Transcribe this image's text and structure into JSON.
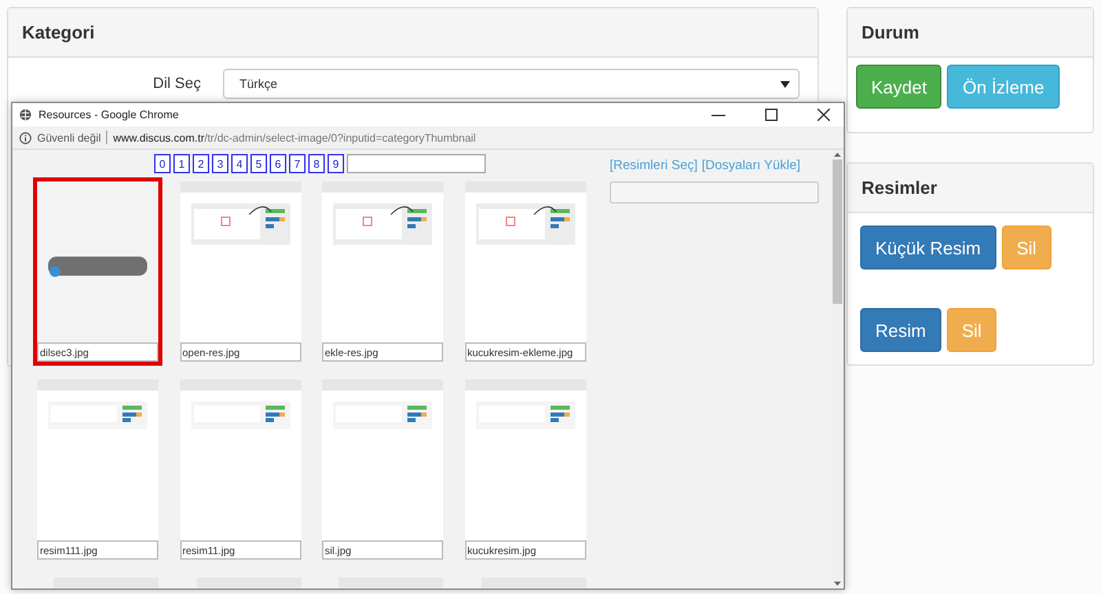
{
  "category_panel": {
    "title": "Kategori",
    "language_label": "Dil Seç",
    "language_value": "Türkçe"
  },
  "status_panel": {
    "title": "Durum",
    "buttons": [
      {
        "label": "Kaydet",
        "kind": "success"
      },
      {
        "label": "Ön İzleme",
        "kind": "info"
      }
    ]
  },
  "images_panel": {
    "title": "Resimler",
    "rows": [
      {
        "buttons": [
          {
            "label": "Küçük Resim",
            "kind": "primary"
          },
          {
            "label": "Sil",
            "kind": "warning"
          }
        ]
      },
      {
        "buttons": [
          {
            "label": "Resim",
            "kind": "primary"
          },
          {
            "label": "Sil",
            "kind": "warning"
          }
        ]
      }
    ]
  },
  "popup": {
    "window_title": "Resources - Google Chrome",
    "security_label": "Güvenli değil",
    "url_host": "www.discus.com.tr",
    "url_path": "/tr/dc-admin/select-image/0?inputid=categoryThumbnail",
    "pages": [
      "0",
      "1",
      "2",
      "3",
      "4",
      "5",
      "6",
      "7",
      "8",
      "9"
    ],
    "links": [
      "[Resimleri Seç]",
      "[Dosyaları Yükle]"
    ],
    "files": [
      {
        "name": "dilsec3.jpg",
        "selected": true
      },
      {
        "name": "open-res.jpg",
        "selected": false
      },
      {
        "name": "ekle-res.jpg",
        "selected": false
      },
      {
        "name": "kucukresim-ekleme.jpg",
        "selected": false
      },
      {
        "name": "resim111.jpg",
        "selected": false
      },
      {
        "name": "resim11.jpg",
        "selected": false
      },
      {
        "name": "sil.jpg",
        "selected": false
      },
      {
        "name": "kucukresim.jpg",
        "selected": false
      }
    ]
  }
}
